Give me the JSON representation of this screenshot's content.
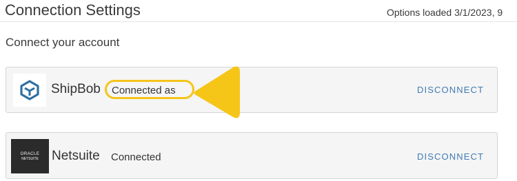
{
  "header": {
    "title": "Connection Settings",
    "status": "Options loaded 3/1/2023, 9"
  },
  "section": {
    "title": "Connect your account"
  },
  "connections": [
    {
      "name": "ShipBob",
      "status": "Connected as",
      "action_label": "DISCONNECT",
      "logo_icon": "shipbob-logo-icon"
    },
    {
      "name": "Netsuite",
      "status": "Connected",
      "action_label": "DISCONNECT",
      "logo_icon": "oracle-netsuite-logo-icon",
      "logo_text_line1": "ORACLE",
      "logo_text_line2": "NETSUITE"
    }
  ],
  "annotation": {
    "color": "#f5c518"
  },
  "colors": {
    "link": "#3f7bb3",
    "card_background": "#f5f5f5",
    "shipbob_brand": "#2f6fa3"
  }
}
